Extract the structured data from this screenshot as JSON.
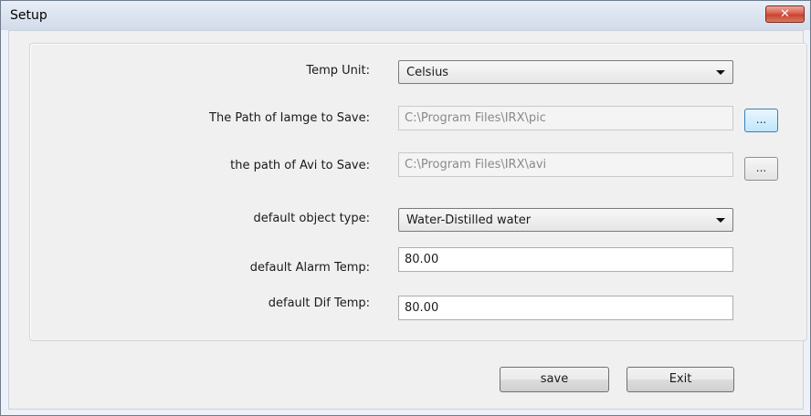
{
  "window": {
    "title": "Setup",
    "close_glyph": "✕"
  },
  "fields": {
    "temp_unit": {
      "label": "Temp Unit:",
      "value": "Celsius"
    },
    "image_path": {
      "label": "The Path of Iamge to Save:",
      "value": "C:\\Program Files\\IRX\\pic",
      "browse_label": "..."
    },
    "avi_path": {
      "label": "the path of Avi to Save:",
      "value": "C:\\Program Files\\IRX\\avi",
      "browse_label": "..."
    },
    "object_type": {
      "label": "default object type:",
      "value": "Water-Distilled water"
    },
    "alarm_temp": {
      "label": "default Alarm Temp:",
      "value": "80.00"
    },
    "dif_temp": {
      "label": "default Dif Temp:",
      "value": "80.00"
    }
  },
  "buttons": {
    "save": "save",
    "exit": "Exit"
  }
}
